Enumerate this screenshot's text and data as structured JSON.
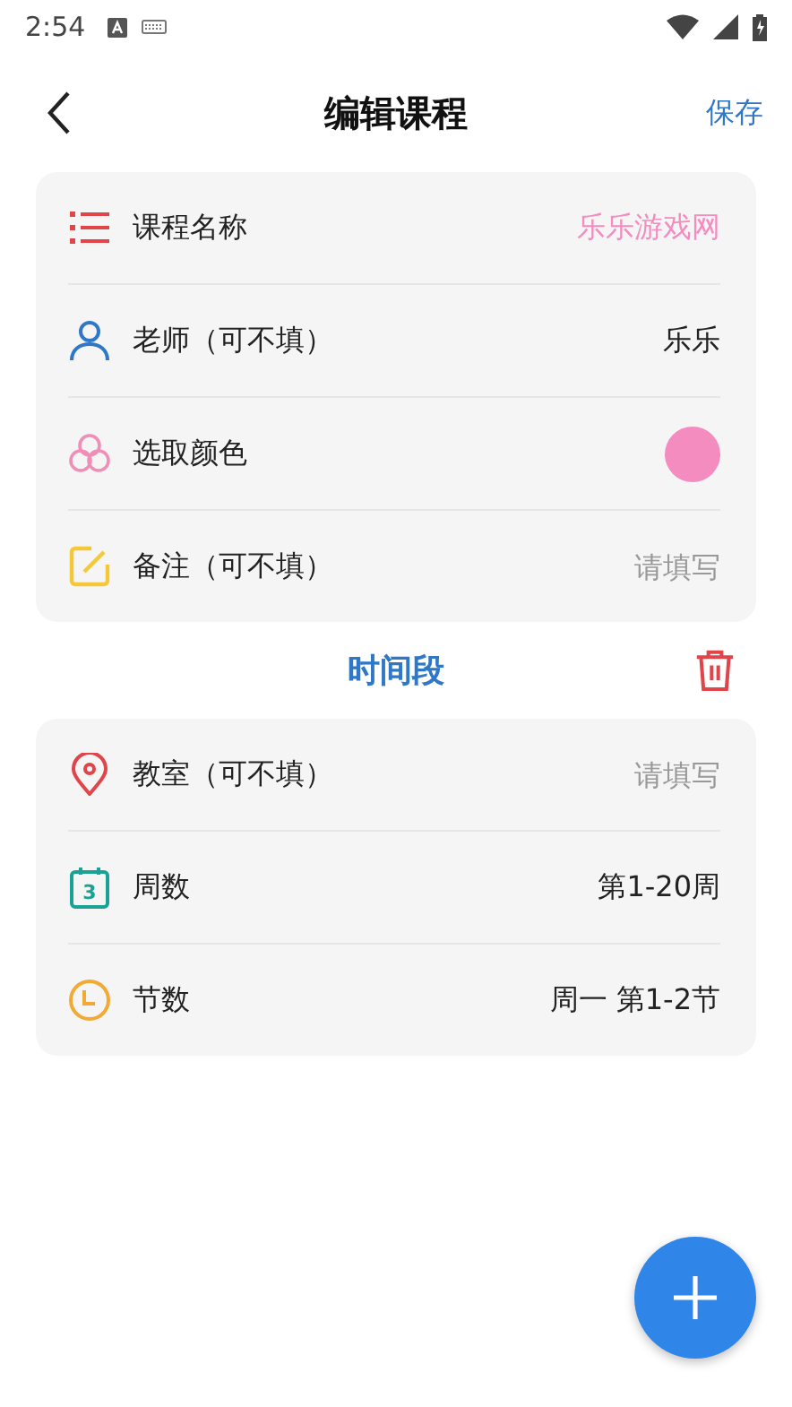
{
  "status_bar": {
    "time": "2:54"
  },
  "header": {
    "title": "编辑课程",
    "action": "保存"
  },
  "course": [
    {
      "kind": "name",
      "label": "课程名称",
      "value": "乐乐游戏网",
      "color": "#f48cc0"
    },
    {
      "kind": "teacher",
      "label": "老师（可不填）",
      "value": "乐乐"
    },
    {
      "kind": "color",
      "label": "选取颜色",
      "color": "#f48cc0"
    },
    {
      "kind": "note",
      "label": "备注（可不填）",
      "placeholder": "请填写"
    }
  ],
  "section": {
    "title": "时间段"
  },
  "time_slot": [
    {
      "kind": "room",
      "label": "教室（可不填）",
      "placeholder": "请填写"
    },
    {
      "kind": "weeks",
      "label": "周数",
      "value": "第1-20周",
      "icon_text": "3"
    },
    {
      "kind": "periods",
      "label": "节数",
      "value": "周一 第1-2节"
    }
  ]
}
